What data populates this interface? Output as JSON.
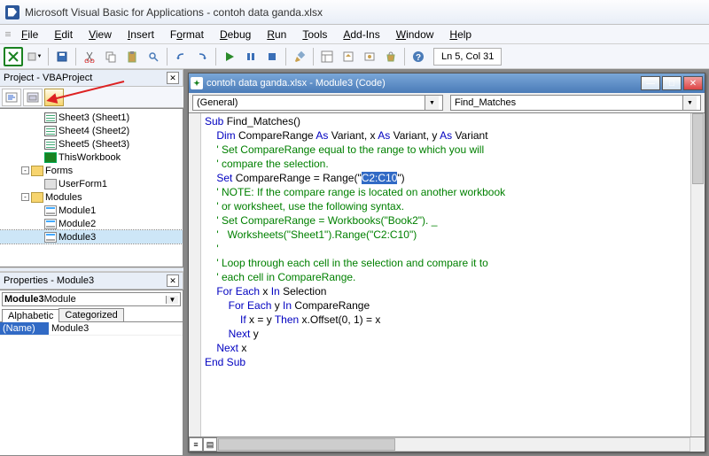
{
  "titlebar": {
    "title": "Microsoft Visual Basic for Applications - contoh data ganda.xlsx"
  },
  "menu": {
    "file": "File",
    "edit": "Edit",
    "view": "View",
    "insert": "Insert",
    "format": "Format",
    "debug": "Debug",
    "run": "Run",
    "tools": "Tools",
    "addins": "Add-Ins",
    "window": "Window",
    "help": "Help"
  },
  "toolbar": {
    "status": "Ln 5, Col 31"
  },
  "project_pane": {
    "title": "Project - VBAProject"
  },
  "tree": {
    "sheet3": "Sheet3 (Sheet1)",
    "sheet4": "Sheet4 (Sheet2)",
    "sheet5": "Sheet5 (Sheet3)",
    "thiswb": "ThisWorkbook",
    "forms": "Forms",
    "userform1": "UserForm1",
    "modules": "Modules",
    "module1": "Module1",
    "module2": "Module2",
    "module3": "Module3"
  },
  "props_pane": {
    "title": "Properties - Module3",
    "combo_bold": "Module3",
    "combo_type": " Module",
    "tab_alpha": "Alphabetic",
    "tab_cat": "Categorized",
    "row_name": "(Name)",
    "row_val": "Module3"
  },
  "codewin": {
    "title": "contoh data ganda.xlsx - Module3 (Code)",
    "combo_left": "(General)",
    "combo_right": "Find_Matches"
  },
  "code": {
    "l1a": "Sub",
    "l1b": " Find_Matches()",
    "l2a": "    ",
    "l2b": "Dim",
    "l2c": " CompareRange ",
    "l2d": "As",
    "l2e": " Variant, x ",
    "l2f": "As",
    "l2g": " Variant, y ",
    "l2h": "As",
    "l2i": " Variant",
    "l3": "    ' Set CompareRange equal to the range to which you will",
    "l4": "    ' compare the selection.",
    "l5a": "    ",
    "l5b": "Set",
    "l5c": " CompareRange = Range(",
    "l5d": "\"",
    "l5e": "C2:C10",
    "l5f": "\"",
    "l5g": ")",
    "l6": "    ' NOTE: If the compare range is located on another workbook",
    "l7": "    ' or worksheet, use the following syntax.",
    "l8": "    ' Set CompareRange = Workbooks(\"Book2\"). _",
    "l9": "    '   Worksheets(\"Sheet1\").Range(\"C2:C10\")",
    "l10": "    '",
    "l11": "    ' Loop through each cell in the selection and compare it to",
    "l12": "    ' each cell in CompareRange.",
    "l13a": "    ",
    "l13b": "For",
    "l13c": " ",
    "l13d": "Each",
    "l13e": " x ",
    "l13f": "In",
    "l13g": " Selection",
    "l14a": "        ",
    "l14b": "For",
    "l14c": " ",
    "l14d": "Each",
    "l14e": " y ",
    "l14f": "In",
    "l14g": " CompareRange",
    "l15a": "            ",
    "l15b": "If",
    "l15c": " x = y ",
    "l15d": "Then",
    "l15e": " x.Offset(0, 1) = x",
    "l16a": "        ",
    "l16b": "Next",
    "l16c": " y",
    "l17a": "    ",
    "l17b": "Next",
    "l17c": " x",
    "l18": "End Sub"
  }
}
